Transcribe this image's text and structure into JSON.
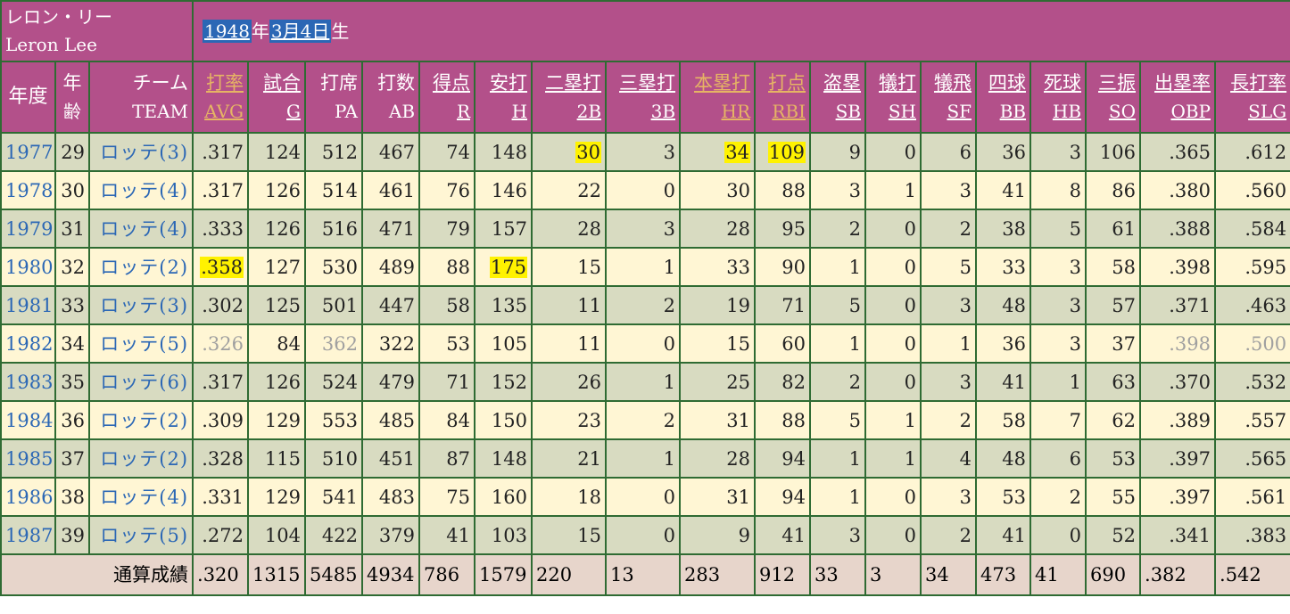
{
  "player": {
    "name_ja": "レロン・リー",
    "name_en": "Leron Lee",
    "birth_year": "1948",
    "year_char": "年",
    "birth_date": "3月4日",
    "birth_suffix": "生"
  },
  "headers": [
    {
      "ja": "年度",
      "en": ""
    },
    {
      "ja": "年",
      "en": "齢"
    },
    {
      "ja": "チーム",
      "en": "TEAM"
    },
    {
      "ja": "打率",
      "en": "AVG"
    },
    {
      "ja": "試合",
      "en": "G"
    },
    {
      "ja": "打席",
      "en": "PA"
    },
    {
      "ja": "打数",
      "en": "AB"
    },
    {
      "ja": "得点",
      "en": "R"
    },
    {
      "ja": "安打",
      "en": "H"
    },
    {
      "ja": "二塁打",
      "en": "2B"
    },
    {
      "ja": "三塁打",
      "en": "3B"
    },
    {
      "ja": "本塁打",
      "en": "HR"
    },
    {
      "ja": "打点",
      "en": "RBI"
    },
    {
      "ja": "盗塁",
      "en": "SB"
    },
    {
      "ja": "犠打",
      "en": "SH"
    },
    {
      "ja": "犠飛",
      "en": "SF"
    },
    {
      "ja": "四球",
      "en": "BB"
    },
    {
      "ja": "死球",
      "en": "HB"
    },
    {
      "ja": "三振",
      "en": "SO"
    },
    {
      "ja": "出塁率",
      "en": "OBP"
    },
    {
      "ja": "長打率",
      "en": "SLG"
    }
  ],
  "rows": [
    [
      "1977",
      "29",
      "ロッテ(3)",
      ".317",
      "124",
      "512",
      "467",
      "74",
      "148",
      "30",
      "3",
      "34",
      "109",
      "9",
      "0",
      "6",
      "36",
      "3",
      "106",
      ".365",
      ".612"
    ],
    [
      "1978",
      "30",
      "ロッテ(4)",
      ".317",
      "126",
      "514",
      "461",
      "76",
      "146",
      "22",
      "0",
      "30",
      "88",
      "3",
      "1",
      "3",
      "41",
      "8",
      "86",
      ".380",
      ".560"
    ],
    [
      "1979",
      "31",
      "ロッテ(4)",
      ".333",
      "126",
      "516",
      "471",
      "79",
      "157",
      "28",
      "3",
      "28",
      "95",
      "2",
      "0",
      "2",
      "38",
      "5",
      "61",
      ".388",
      ".584"
    ],
    [
      "1980",
      "32",
      "ロッテ(2)",
      ".358",
      "127",
      "530",
      "489",
      "88",
      "175",
      "15",
      "1",
      "33",
      "90",
      "1",
      "0",
      "5",
      "33",
      "3",
      "58",
      ".398",
      ".595"
    ],
    [
      "1981",
      "33",
      "ロッテ(3)",
      ".302",
      "125",
      "501",
      "447",
      "58",
      "135",
      "11",
      "2",
      "19",
      "71",
      "5",
      "0",
      "3",
      "48",
      "3",
      "57",
      ".371",
      ".463"
    ],
    [
      "1982",
      "34",
      "ロッテ(5)",
      ".326",
      "84",
      "362",
      "322",
      "53",
      "105",
      "11",
      "0",
      "15",
      "60",
      "1",
      "0",
      "1",
      "36",
      "3",
      "37",
      ".398",
      ".500"
    ],
    [
      "1983",
      "35",
      "ロッテ(6)",
      ".317",
      "126",
      "524",
      "479",
      "71",
      "152",
      "26",
      "1",
      "25",
      "82",
      "2",
      "0",
      "3",
      "41",
      "1",
      "63",
      ".370",
      ".532"
    ],
    [
      "1984",
      "36",
      "ロッテ(2)",
      ".309",
      "129",
      "553",
      "485",
      "84",
      "150",
      "23",
      "2",
      "31",
      "88",
      "5",
      "1",
      "2",
      "58",
      "7",
      "62",
      ".389",
      ".557"
    ],
    [
      "1985",
      "37",
      "ロッテ(2)",
      ".328",
      "115",
      "510",
      "451",
      "87",
      "148",
      "21",
      "1",
      "28",
      "94",
      "1",
      "1",
      "4",
      "48",
      "6",
      "53",
      ".397",
      ".565"
    ],
    [
      "1986",
      "38",
      "ロッテ(4)",
      ".331",
      "129",
      "541",
      "483",
      "75",
      "160",
      "18",
      "0",
      "31",
      "94",
      "1",
      "0",
      "3",
      "53",
      "2",
      "55",
      ".397",
      ".561"
    ],
    [
      "1987",
      "39",
      "ロッテ(5)",
      ".272",
      "104",
      "422",
      "379",
      "41",
      "103",
      "15",
      "0",
      "9",
      "41",
      "3",
      "0",
      "2",
      "41",
      "0",
      "52",
      ".341",
      ".383"
    ]
  ],
  "highlights": [
    [
      0,
      9
    ],
    [
      0,
      11
    ],
    [
      0,
      12
    ],
    [
      3,
      3
    ],
    [
      3,
      8
    ]
  ],
  "dimmed": [
    [
      5,
      3
    ],
    [
      5,
      5
    ],
    [
      5,
      19
    ],
    [
      5,
      20
    ]
  ],
  "total": {
    "label": "通算成績",
    "values": [
      ".320",
      "1315",
      "5485",
      "4934",
      "786",
      "1579",
      "220",
      "13",
      "283",
      "912",
      "33",
      "3",
      "34",
      "473",
      "41",
      "690",
      ".382",
      ".542"
    ]
  },
  "colors": {
    "header_bg": "#b3508a",
    "row_odd": "#d8dbc1",
    "row_even": "#fff6d4",
    "total_bg": "#e7d5cb",
    "highlight": "#fff200",
    "link": "#2b67b5",
    "border": "#2f6b33"
  }
}
